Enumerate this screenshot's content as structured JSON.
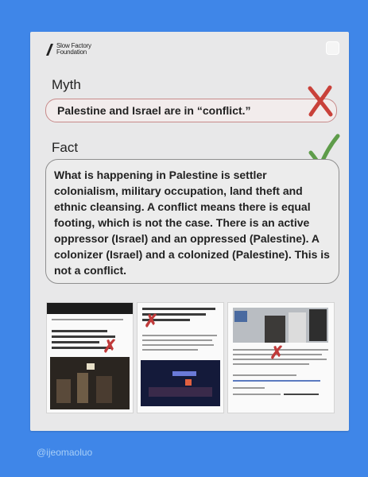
{
  "brand": {
    "line1": "Slow Factory",
    "line2": "Foundation"
  },
  "myth": {
    "heading": "Myth",
    "statement": "Palestine and Israel are in “conflict.”",
    "mark_icon": "red-x-icon",
    "mark_color": "#c9413a"
  },
  "fact": {
    "heading": "Fact",
    "statement": "What is happening in Palestine is settler colonialism, military occupation, land theft and ethnic cleansing. A conflict means there is equal footing, which is not the case. There is an active oppressor (Israel) and an oppressed (Palestine). A colonizer (Israel) and a colonized (Palestine). This is not a conflict.",
    "mark_icon": "green-check-icon",
    "mark_color": "#5e9c4a"
  },
  "thumbnails": [
    "news-article-thumbnail",
    "news-article-thumbnail",
    "news-article-thumbnail"
  ],
  "footer": {
    "handle": "@ijeomaoluo"
  },
  "colors": {
    "background": "#3f86e8",
    "card": "#e8e8e9"
  }
}
